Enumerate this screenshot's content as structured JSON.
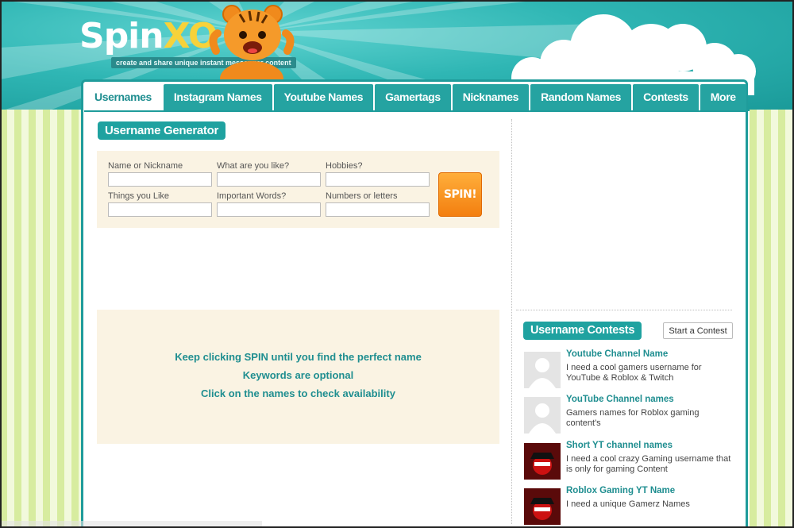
{
  "logo": {
    "part1": "Spin",
    "part2": "XO",
    "tagline": "create and share unique instant messenger content"
  },
  "tabs": [
    {
      "label": "Usernames",
      "active": true
    },
    {
      "label": "Instagram Names"
    },
    {
      "label": "Youtube Names"
    },
    {
      "label": "Gamertags"
    },
    {
      "label": "Nicknames"
    },
    {
      "label": "Random Names"
    },
    {
      "label": "Contests"
    },
    {
      "label": "More"
    }
  ],
  "generator": {
    "title": "Username Generator",
    "fields": [
      {
        "label": "Name or Nickname",
        "value": ""
      },
      {
        "label": "What are you like?",
        "value": ""
      },
      {
        "label": "Hobbies?",
        "value": ""
      },
      {
        "label": "Things you Like",
        "value": ""
      },
      {
        "label": "Important Words?",
        "value": ""
      },
      {
        "label": "Numbers or letters",
        "value": ""
      }
    ],
    "spin_label": "SPIN!"
  },
  "info": {
    "line1": "Keep clicking SPIN until you find the perfect name",
    "line2": "Keywords are optional",
    "line3": "Click on the names to check availability"
  },
  "contests": {
    "title": "Username Contests",
    "start_label": "Start a Contest",
    "items": [
      {
        "title": "Youtube Channel Name",
        "desc": "I need a cool gamers username for YouTube & Roblox & Twitch",
        "thumb": "default-avatar-icon"
      },
      {
        "title": "YouTube Channel names",
        "desc": "Gamers names for Roblox gaming content's",
        "thumb": "default-avatar-icon"
      },
      {
        "title": "Short YT channel names",
        "desc": "I need a cool crazy Gaming username that is only for gaming Content",
        "thumb": "gamer-avatar-icon"
      },
      {
        "title": "Roblox Gaming YT Name",
        "desc": "I need a unique Gamerz Names",
        "thumb": "gamer-avatar-icon"
      }
    ]
  },
  "colors": {
    "teal": "#1fa2a0",
    "orange": "#f58a1f",
    "cream": "#faf3e3",
    "stripe_green": "#d7ec9f"
  }
}
